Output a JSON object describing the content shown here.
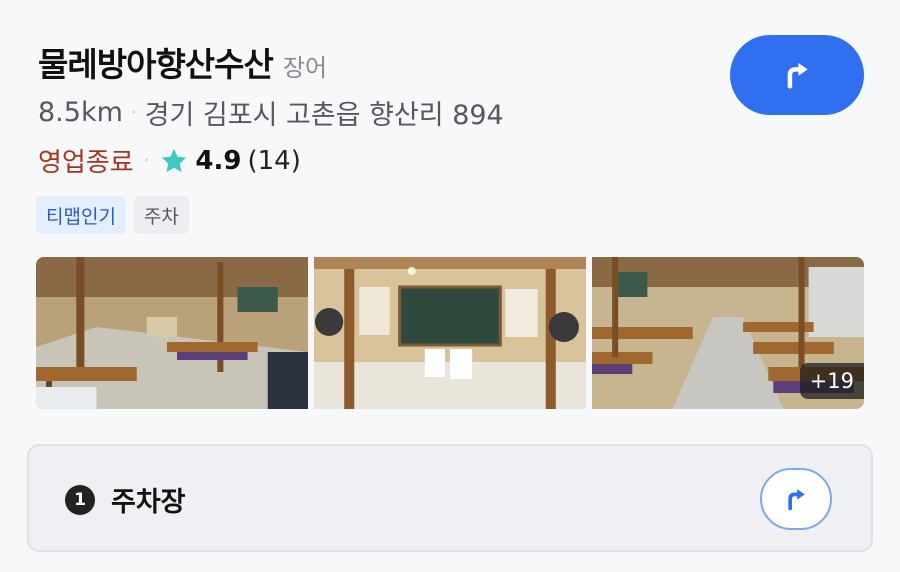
{
  "place": {
    "name": "물레방아향산수산",
    "category": "장어",
    "distance": "8.5km",
    "address": "경기 김포시 고촌읍 향산리 894",
    "status": "영업종료",
    "rating": "4.9",
    "review_count": "(14)"
  },
  "tags": [
    "티맵인기",
    "주차"
  ],
  "photos": {
    "more_count": "+19"
  },
  "parking": {
    "number": "1",
    "label": "주차장"
  },
  "colors": {
    "accent": "#2f6ff0",
    "status_closed": "#a8321d",
    "star": "#3ec8c0",
    "tag_blue_bg": "#e3efff"
  },
  "icons": {
    "navigate": "turn-right-arrow-icon",
    "rating": "star-icon"
  }
}
